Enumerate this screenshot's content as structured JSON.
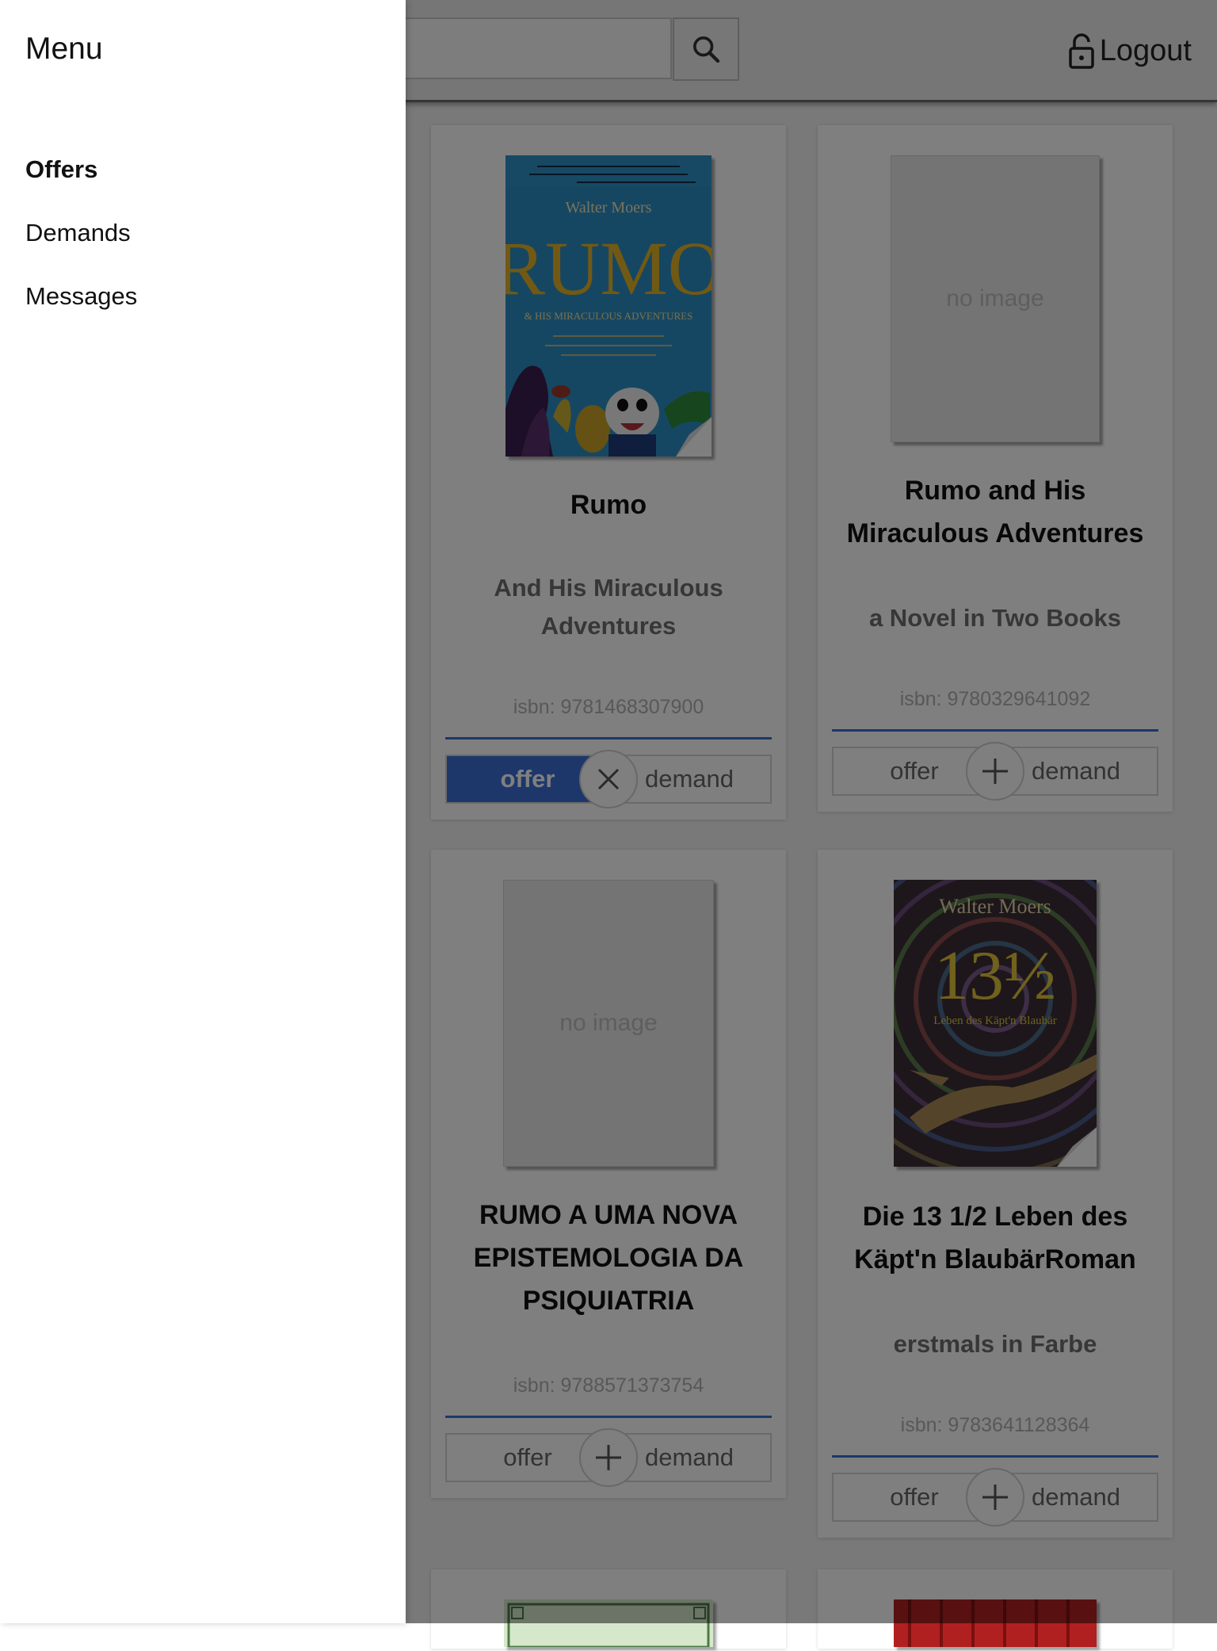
{
  "header": {
    "search_placeholder": "",
    "logout_label": "Logout"
  },
  "drawer": {
    "title": "Menu",
    "items": [
      {
        "label": "Offers",
        "active": true
      },
      {
        "label": "Demands",
        "active": false
      },
      {
        "label": "Messages",
        "active": false
      }
    ]
  },
  "cards": [
    {
      "cover": "book-cover-rumo",
      "cover_author": "Walter Moers",
      "cover_title": "RUMO",
      "cover_subtitle": "& HIS MIRACULOUS ADVENTURES",
      "title": "Rumo",
      "subtitle": "And His Miraculous Adventures",
      "isbn": "isbn: 9781468307900",
      "offer_label": "offer",
      "demand_label": "demand",
      "offer_active": true,
      "toggle_icon": "close-icon"
    },
    {
      "cover": "no-image",
      "no_image_label": "no image",
      "title": "Rumo and His Miraculous Adventures",
      "subtitle": "a Novel in Two Books",
      "isbn": "isbn: 9780329641092",
      "offer_label": "offer",
      "demand_label": "demand",
      "offer_active": false,
      "toggle_icon": "plus-icon"
    },
    {
      "cover": "no-image",
      "no_image_label": "no image",
      "title": "RUMO A UMA NOVA EPISTEMOLOGIA DA PSIQUIATRIA",
      "subtitle": "",
      "isbn": "isbn: 9788571373754",
      "offer_label": "offer",
      "demand_label": "demand",
      "offer_active": false,
      "toggle_icon": "plus-icon"
    },
    {
      "cover": "book-cover-13-1-2",
      "cover_author": "Walter Moers",
      "cover_title": "13½",
      "cover_subtitle": "Leben des Käpt'n Blaubär",
      "title": "Die 13 1/2 Leben des Käpt'n BlaubärRoman",
      "subtitle": "erstmals in Farbe",
      "isbn": "isbn: 9783641128364",
      "offer_label": "offer",
      "demand_label": "demand",
      "offer_active": false,
      "toggle_icon": "plus-icon"
    }
  ],
  "colors": {
    "accent": "#3b6fd6",
    "scrim": "rgba(0,0,0,0.5)"
  }
}
